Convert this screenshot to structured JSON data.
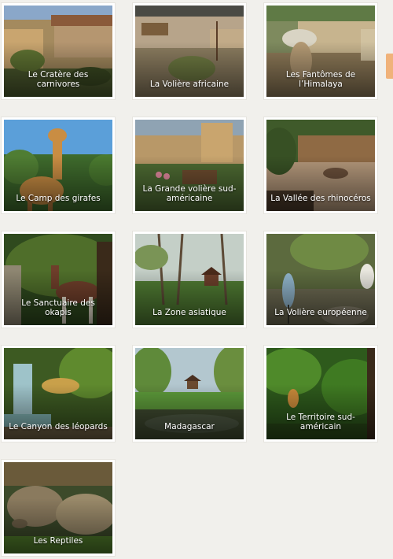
{
  "zones": [
    {
      "label": "Le Cratère des carnivores",
      "icon": "zone-photo"
    },
    {
      "label": "La Volière africaine",
      "icon": "zone-photo"
    },
    {
      "label": "Les Fantômes de l’Himalaya",
      "icon": "zone-photo"
    },
    {
      "label": "Le Camp des girafes",
      "icon": "zone-photo"
    },
    {
      "label": "La Grande volière sud-américaine",
      "icon": "zone-photo"
    },
    {
      "label": "La Vallée des rhinocéros",
      "icon": "zone-photo"
    },
    {
      "label": "Le Sanctuaire des okapis",
      "icon": "zone-photo"
    },
    {
      "label": "La Zone asiatique",
      "icon": "zone-photo"
    },
    {
      "label": "La Volière européenne",
      "icon": "zone-photo"
    },
    {
      "label": "Le Canyon des léopards",
      "icon": "zone-photo"
    },
    {
      "label": "Madagascar",
      "icon": "zone-photo"
    },
    {
      "label": "Le Territoire sud-américain",
      "icon": "zone-photo"
    },
    {
      "label": "Les Reptiles",
      "icon": "zone-photo"
    }
  ],
  "colors": {
    "background": "#f1f0ec",
    "card_border": "#ffffff",
    "side_tab": "#f0b27a"
  }
}
